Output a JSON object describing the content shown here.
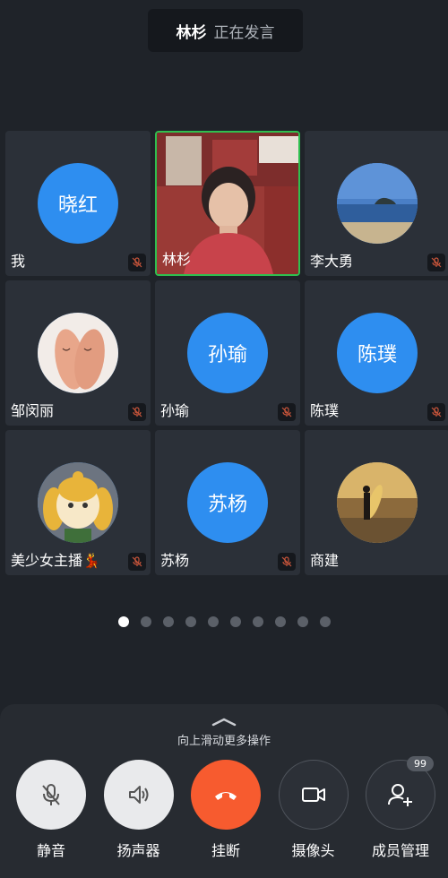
{
  "banner": {
    "name": "林杉",
    "status": "正在发言"
  },
  "participants": [
    {
      "name": "我",
      "avatar_text": "晓红",
      "avatar": "text-circle",
      "muted": true
    },
    {
      "name": "林杉",
      "avatar": "live-video",
      "muted": false,
      "active": true
    },
    {
      "name": "李大勇",
      "avatar": "photo-seascape",
      "muted": true
    },
    {
      "name": "邹闵丽",
      "avatar": "photo-finger-faces",
      "muted": false
    },
    {
      "name": "孙瑜",
      "avatar_text": "孙瑜",
      "avatar": "text-circle",
      "muted": true
    },
    {
      "name": "陈璞",
      "avatar_text": "陈璞",
      "avatar": "text-circle",
      "muted": true
    },
    {
      "name": "美少女主播💃",
      "avatar": "photo-cartoon-dog",
      "muted": true
    },
    {
      "name": "苏杨",
      "avatar_text": "苏杨",
      "avatar": "text-circle",
      "muted": true
    },
    {
      "name": "商建",
      "avatar": "photo-surfer-sunset",
      "muted": false
    }
  ],
  "pager": {
    "count": 10,
    "current": 1
  },
  "panel": {
    "hint": "向上滑动更多操作",
    "controls": [
      {
        "label": "静音",
        "icon": "mic-muted-icon"
      },
      {
        "label": "扬声器",
        "icon": "speaker-icon"
      },
      {
        "label": "挂断",
        "icon": "hang-up-icon"
      },
      {
        "label": "摄像头",
        "icon": "camera-icon"
      },
      {
        "label": "成员管理",
        "icon": "add-member-icon",
        "badge": "99"
      }
    ]
  },
  "colors": {
    "avatar_blue": "#2e8ef0",
    "active_border": "#2fbf4f",
    "hangup_red": "#f75b2f"
  }
}
